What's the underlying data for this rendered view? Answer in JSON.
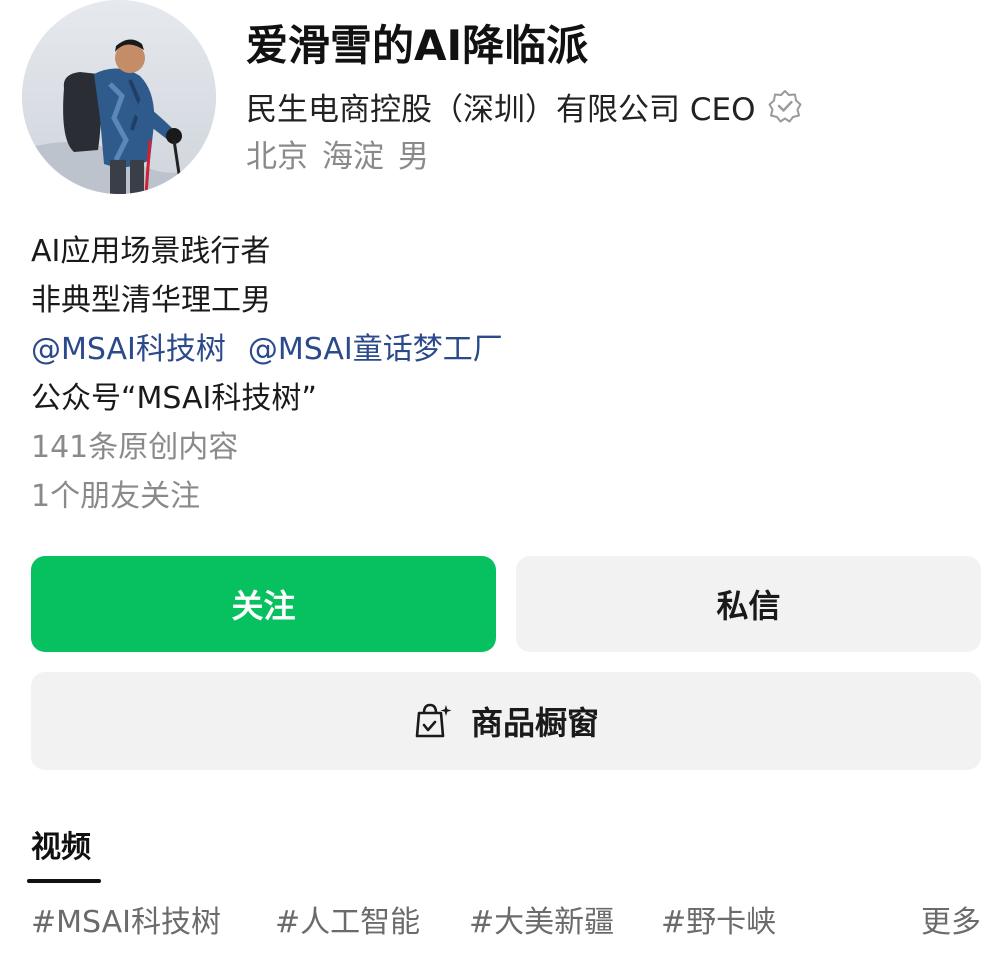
{
  "profile": {
    "display_name": "爱滑雪的AI降临派",
    "company": "民生电商控股（深圳）有限公司 CEO",
    "verified_icon": "verified-badge-icon",
    "location": [
      "北京",
      "海淀",
      "男"
    ]
  },
  "bio": {
    "line1": "AI应用场景践行者",
    "line2": "非典型清华理工男",
    "mentions": [
      "@MSAI科技树",
      "@MSAI童话梦工厂"
    ],
    "line4": "公众号“MSAI科技树”",
    "original_content": "141条原创内容",
    "friends_following": "1个朋友关注"
  },
  "actions": {
    "follow_label": "关注",
    "message_label": "私信",
    "shop_label": "商品橱窗",
    "shop_icon": "shopping-bag-sparkle-icon"
  },
  "tabs": {
    "video_label": "视频"
  },
  "tags": [
    "#MSAI科技树",
    "#人工智能",
    "#大美新疆",
    "#野卡峡"
  ],
  "more_label": "更多",
  "colors": {
    "accent_green": "#07c160",
    "link_blue": "#2b4a8b",
    "muted_gray": "#8a8a8a",
    "button_gray": "#f2f2f2"
  }
}
